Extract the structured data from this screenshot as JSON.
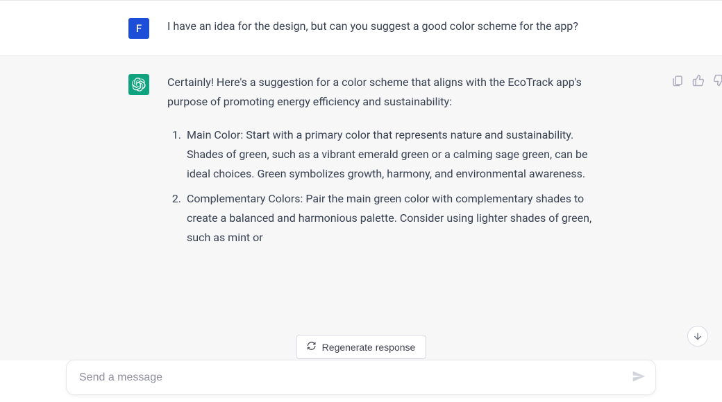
{
  "user_message": {
    "avatar_letter": "F",
    "text": "I have an idea for the design, but can you suggest a good color scheme for the app?"
  },
  "assistant_message": {
    "intro": "Certainly! Here's a suggestion for a color scheme that aligns with the EcoTrack app's purpose of promoting energy efficiency and sustainability:",
    "list_items": [
      "Main Color: Start with a primary color that represents nature and sustainability. Shades of green, such as a vibrant emerald green or a calming sage green, can be ideal choices. Green symbolizes growth, harmony, and environmental awareness.",
      "Complementary Colors: Pair the main green color with complementary shades to create a balanced and harmonious palette. Consider using lighter shades of green, such as mint or"
    ]
  },
  "regenerate_label": "Regenerate response",
  "input_placeholder": "Send a message"
}
